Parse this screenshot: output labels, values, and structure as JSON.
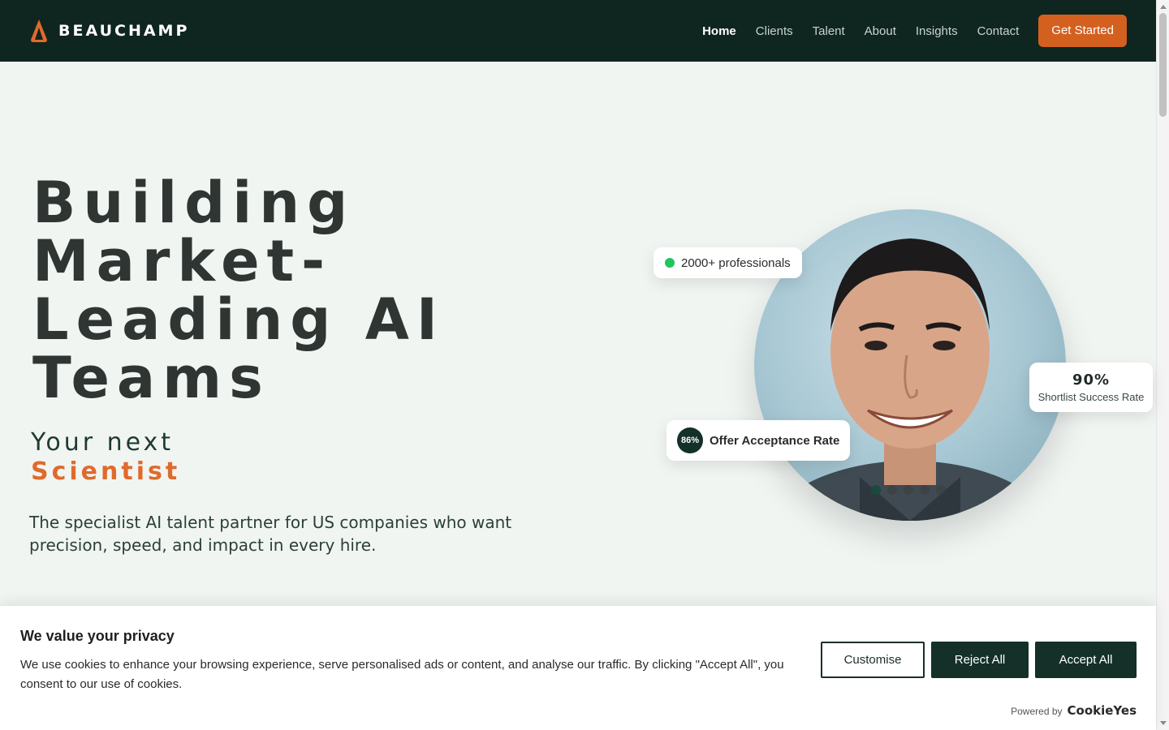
{
  "header": {
    "brand": "BEAUCHAMP",
    "logo_icon": "flame-logo-icon",
    "nav": [
      {
        "label": "Home",
        "active": true
      },
      {
        "label": "Clients",
        "active": false
      },
      {
        "label": "Talent",
        "active": false
      },
      {
        "label": "About",
        "active": false
      },
      {
        "label": "Insights",
        "active": false
      },
      {
        "label": "Contact",
        "active": false
      }
    ],
    "cta_label": "Get Started"
  },
  "hero": {
    "title": "Building Market-Leading AI Teams",
    "subtitle_prefix": "Your next",
    "subtitle_role": "Scientist",
    "description": "The specialist AI talent partner for US companies who want precision, speed, and impact in every hire."
  },
  "stats": {
    "professionals": "2000+ professionals",
    "shortlist_value": "90%",
    "shortlist_label": "Shortlist Success Rate",
    "offer_value": "86%",
    "offer_label": "Offer Acceptance Rate"
  },
  "carousel": {
    "total_slides": 5,
    "active_slide": 1
  },
  "cookie": {
    "title": "We value your privacy",
    "text": "We use cookies to enhance your browsing experience, serve personalised ads or content, and analyse our traffic. By clicking \"Accept All\", you consent to our use of cookies.",
    "customise_label": "Customise",
    "reject_label": "Reject All",
    "accept_label": "Accept All",
    "powered_by": "Powered by",
    "powered_brand": "CookieYes"
  },
  "colors": {
    "header_bg": "#0f2520",
    "accent": "#d4601f",
    "page_bg": "#f1f5f2",
    "button_dark": "#143028",
    "status_green": "#22c55e"
  }
}
